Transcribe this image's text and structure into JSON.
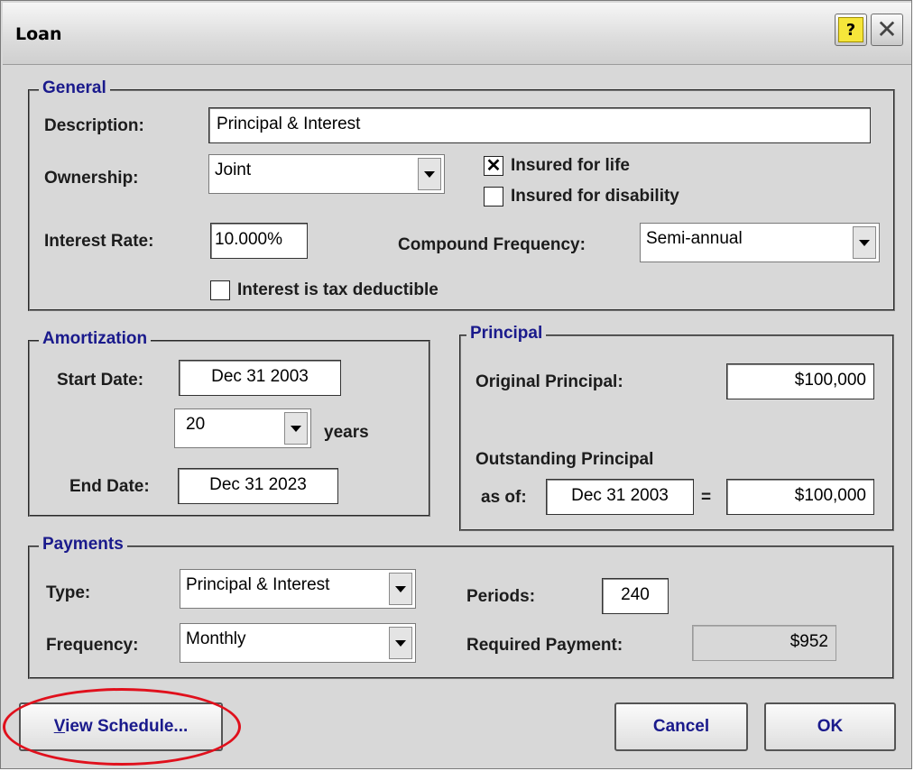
{
  "window": {
    "title": "Loan",
    "help_label": "?",
    "close_label": "✕"
  },
  "general": {
    "legend": "General",
    "description_label": "Description:",
    "description_value": "Principal & Interest",
    "ownership_label": "Ownership:",
    "ownership_value": "Joint",
    "insured_life_label": "Insured for life",
    "insured_life_checked": true,
    "insured_disability_label": "Insured for disability",
    "insured_disability_checked": false,
    "interest_rate_label": "Interest Rate:",
    "interest_rate_value": "10.000%",
    "compound_label": "Compound Frequency:",
    "compound_value": "Semi-annual",
    "tax_deductible_label": "Interest is tax deductible",
    "tax_deductible_checked": false
  },
  "amortization": {
    "legend": "Amortization",
    "start_label": "Start Date:",
    "start_value": "Dec 31 2003",
    "years_value": "20",
    "years_label": "years",
    "end_label": "End Date:",
    "end_value": "Dec 31 2023"
  },
  "principal": {
    "legend": "Principal",
    "original_label": "Original Principal:",
    "original_value": "$100,000",
    "outstanding_label": "Outstanding Principal",
    "as_of_label": "as of:",
    "as_of_value": "Dec 31 2003",
    "equals": "=",
    "outstanding_value": "$100,000"
  },
  "payments": {
    "legend": "Payments",
    "type_label": "Type:",
    "type_value": "Principal & Interest",
    "frequency_label": "Frequency:",
    "frequency_value": "Monthly",
    "periods_label": "Periods:",
    "periods_value": "240",
    "required_label": "Required Payment:",
    "required_value": "$952"
  },
  "buttons": {
    "view_schedule": "View Schedule...",
    "cancel": "Cancel",
    "ok": "OK"
  },
  "colors": {
    "annotation": "#e0101c",
    "group_title": "#1a1a8c",
    "dialog_bg": "#d8d8d8"
  },
  "icons": {
    "help": "help-icon",
    "close": "close-icon",
    "dropdown": "chevron-down-icon"
  }
}
